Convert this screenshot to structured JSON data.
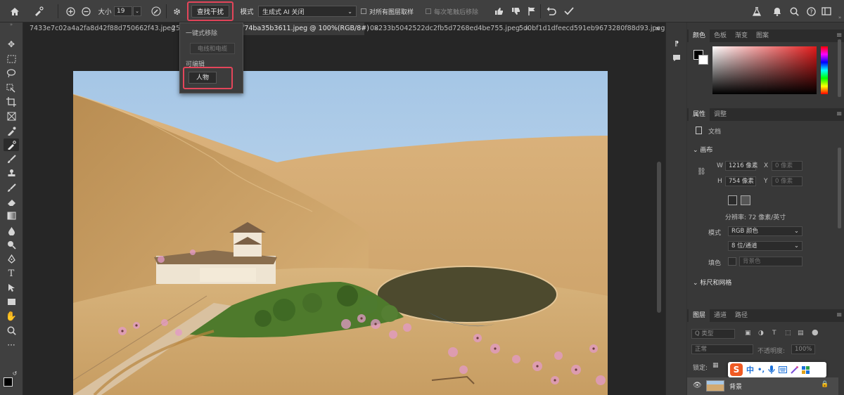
{
  "options": {
    "size_label": "大小",
    "size_value": "19",
    "find_button": "查找干扰",
    "mode_label": "模式",
    "mode_value": "生成式 AI 关闭",
    "sample_all": "对所有图层取样",
    "remove_each": "每次笔触后移除"
  },
  "tabs": [
    {
      "label": "7433e7c02a4a2fa8d42f88d750662f43.jpeg",
      "close": "×"
    },
    {
      "label": "25",
      "close": ""
    },
    {
      "label": "f74ba35b3611.jpeg @ 100%(RGB/8#)",
      "close": "×"
    },
    {
      "label": "08233b5042522dc2fb5d7268ed4be755.jpeg",
      "close": "×"
    },
    {
      "label": "5d0bf1d1dfeecd591eb9673280f88d93.jpeg",
      "close": ""
    }
  ],
  "tabs_overflow": "»",
  "dropdown": {
    "section1": "一键式移除",
    "item_wires": "电线和电缆",
    "section2": "可编辑",
    "item_people": "人物"
  },
  "color_panel": {
    "tabs": [
      "颜色",
      "色板",
      "渐变",
      "图案"
    ],
    "active": "#e21b1b"
  },
  "properties": {
    "tabs": [
      "属性",
      "调整"
    ],
    "doc_label": "文档",
    "canvas_header": "画布",
    "w_label": "W",
    "w_value": "1216 像素",
    "x_label": "X",
    "x_value": "0 像素",
    "h_label": "H",
    "h_value": "754 像素",
    "y_label": "Y",
    "y_value": "0 像素",
    "resolution": "分辨率: 72 像素/英寸",
    "mode_label": "模式",
    "mode_value": "RGB 颜色",
    "depth_value": "8 位/通道",
    "fill_label": "填色",
    "fill_value": "背景色",
    "rulers_header": "标尺和网格"
  },
  "layers": {
    "tabs": [
      "图层",
      "通道",
      "路径"
    ],
    "search_placeholder": "Q 类型",
    "blend_mode": "正常",
    "opacity_label": "不透明度:",
    "opacity_value": "100%",
    "lock_label": "锁定:",
    "layer_name": "背景"
  },
  "ime_toolbar": {
    "logo": "S",
    "lang": "中",
    "punct": "•,"
  }
}
